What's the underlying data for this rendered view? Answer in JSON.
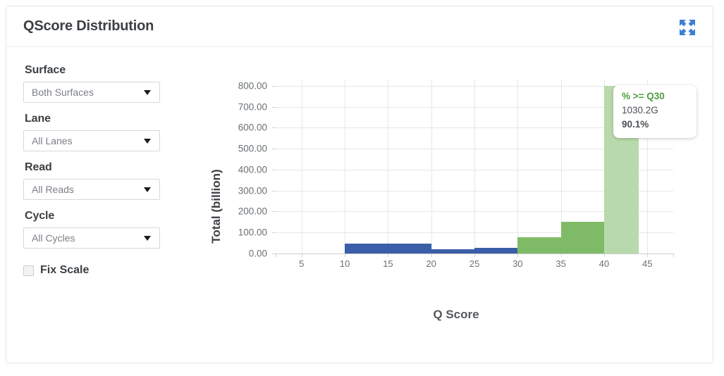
{
  "card": {
    "title": "QScore Distribution",
    "expand_icon": "expand-arrows-icon"
  },
  "controls": {
    "surface": {
      "label": "Surface",
      "value": "Both Surfaces",
      "caret_icon": "chevron-down-icon"
    },
    "lane": {
      "label": "Lane",
      "value": "All Lanes",
      "caret_icon": "chevron-down-icon"
    },
    "read": {
      "label": "Read",
      "value": "All Reads",
      "caret_icon": "chevron-down-icon"
    },
    "cycle": {
      "label": "Cycle",
      "value": "All Cycles",
      "caret_icon": "chevron-down-icon"
    },
    "fix_scale": {
      "label": "Fix Scale",
      "checked": false
    }
  },
  "tooltip": {
    "title": "% >= Q30",
    "total": "1030.2G",
    "percent": "90.1%"
  },
  "chart_data": {
    "type": "bar",
    "title": "",
    "xlabel": "Q Score",
    "ylabel": "Total (billion)",
    "xlim": [
      2,
      48
    ],
    "ylim": [
      0,
      830
    ],
    "ytick_values": [
      0,
      100,
      200,
      300,
      400,
      500,
      600,
      700,
      800
    ],
    "ytick_labels": [
      "0.00",
      "100.00",
      "200.00",
      "300.00",
      "400.00",
      "500.00",
      "600.00",
      "700.00",
      "800.00"
    ],
    "xtick_values": [
      5,
      10,
      15,
      20,
      25,
      30,
      35,
      40,
      45
    ],
    "xtick_labels": [
      "5",
      "10",
      "15",
      "20",
      "25",
      "30",
      "35",
      "40",
      "45"
    ],
    "grid": true,
    "legend": false,
    "colors": {
      "below_q30": "#3b5ea8",
      "at_or_above_q30": "#7fbb67",
      "highlight": "#b7daa6"
    },
    "q30_threshold": 30,
    "highlight_range": [
      40,
      44
    ],
    "bins": [
      {
        "x_start": 10,
        "x_end": 20,
        "value": 48,
        "color": "below_q30"
      },
      {
        "x_start": 20,
        "x_end": 25,
        "value": 19,
        "color": "below_q30"
      },
      {
        "x_start": 25,
        "x_end": 30,
        "value": 26,
        "color": "below_q30"
      },
      {
        "x_start": 30,
        "x_end": 35,
        "value": 78,
        "color": "at_or_above_q30"
      },
      {
        "x_start": 35,
        "x_end": 40,
        "value": 152,
        "color": "at_or_above_q30"
      },
      {
        "x_start": 40,
        "x_end": 44,
        "value": 800,
        "color": "at_or_above_q30"
      }
    ]
  }
}
